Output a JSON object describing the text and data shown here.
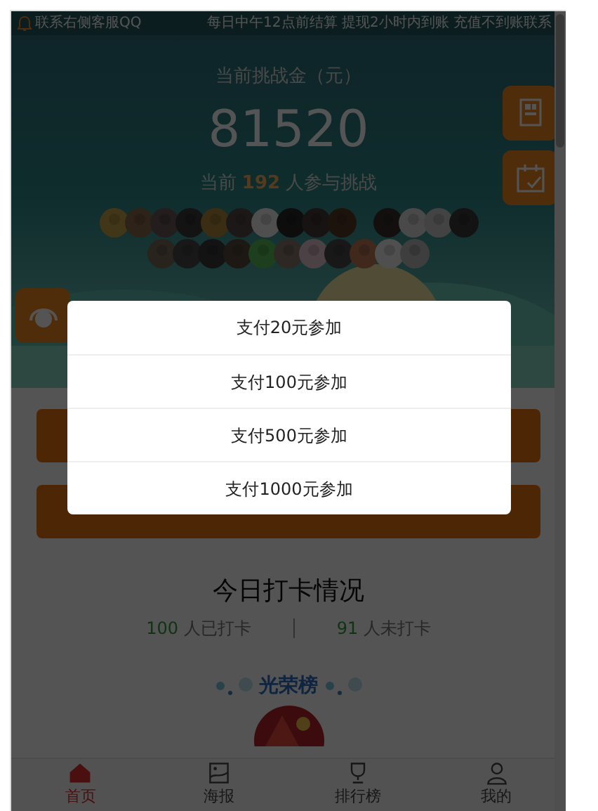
{
  "marquee": {
    "left": "联系右侧客服QQ",
    "right": "每日中午12点前结算 提现2小时内到账 充值不到账联系"
  },
  "challenge": {
    "label": "当前挑战金（元）",
    "amount": "81520",
    "prefix": "当前",
    "count": "192",
    "suffix": "人参与挑战"
  },
  "checkin": {
    "title": "今日打卡情况",
    "done_count": "100",
    "done_label": "人已打卡",
    "todo_count": "91",
    "todo_label": "人未打卡"
  },
  "honor": {
    "title": "光荣榜"
  },
  "dialog": {
    "options": [
      "支付20元参加",
      "支付100元参加",
      "支付500元参加",
      "支付1000元参加"
    ]
  },
  "tab_bar": [
    {
      "label": "首页",
      "selected": true
    },
    {
      "label": "海报",
      "selected": false
    },
    {
      "label": "排行榜",
      "selected": false
    },
    {
      "label": "我的",
      "selected": false
    }
  ]
}
